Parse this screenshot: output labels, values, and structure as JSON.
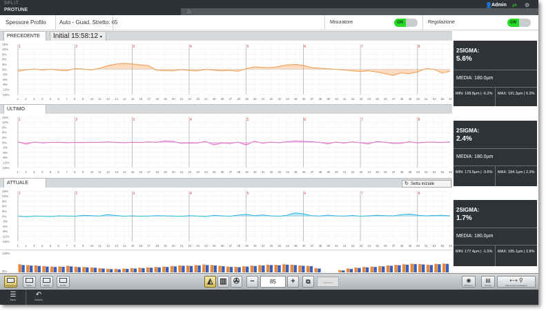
{
  "app": {
    "brand": "SPLIT",
    "product": "PROTUNE",
    "user": "Admin"
  },
  "header": {
    "profile_label": "Spessore Profilo",
    "mode": "Auto - Guad. Stretto: 65",
    "measurer_label": "Misuratore",
    "measurer_state": "ON",
    "regulation_label": "Regolazione",
    "regulation_state": "ON"
  },
  "panels": {
    "precedente": {
      "tab": "PRECEDENTE",
      "time": "Initial 15:58:12",
      "sigma_label": "2SIGMA:",
      "sigma_value": "5.6%",
      "media": "MEDIA: 180.0µm",
      "min": "MIN: 168.8µm | -6.2%",
      "max": "MAX: 191.3µm | 6.3%",
      "color": "#f39a4a"
    },
    "ultimo": {
      "tab": "ULTIMO",
      "sigma_label": "2SIGMA:",
      "sigma_value": "2.4%",
      "media": "MEDIA: 180.0µm",
      "min": "MIN: 173.5µm | -3.6%",
      "max": "MAX: 184.1µm | 2.3%",
      "color": "#e566c8"
    },
    "attuale": {
      "tab": "ATTUALE",
      "setta_label": "Setta iniziale",
      "sigma_label": "2SIGMA:",
      "sigma_value": "1.7%",
      "media": "MEDIA: 180.0µm",
      "min": "MIN: 177.4µm | -1.5%",
      "max": "MAX: 185.1µm | 2.8%",
      "color": "#2ab7e8"
    }
  },
  "chart_data": [
    {
      "type": "area",
      "name": "PRECEDENTE",
      "x": [
        1,
        2,
        3,
        4,
        5,
        6,
        7,
        8,
        9,
        10,
        11,
        12,
        13,
        14,
        15,
        16,
        17,
        18,
        19,
        20,
        21,
        22,
        23,
        24,
        25,
        26,
        27,
        28,
        29,
        30,
        31,
        32,
        33,
        34,
        35,
        36,
        37,
        38,
        39,
        40,
        41,
        42,
        43,
        44,
        45,
        46,
        47,
        48,
        49,
        50,
        51,
        52,
        53,
        54
      ],
      "values": [
        -1.2,
        -0.3,
        0.2,
        -0.5,
        0.1,
        -0.6,
        -0.8,
        0.4,
        0.2,
        -0.4,
        0.6,
        2.1,
        3.1,
        3.6,
        3.2,
        2.6,
        2.2,
        -0.6,
        -0.8,
        -0.9,
        -0.2,
        -0.7,
        -1.0,
        -0.1,
        -0.5,
        -0.9,
        -0.6,
        -1.2,
        0.4,
        1.5,
        1.2,
        1.0,
        1.7,
        2.6,
        2.9,
        2.3,
        1.1,
        0.6,
        0.3,
        0.0,
        -0.4,
        -1.0,
        -1.3,
        -0.9,
        -1.6,
        -2.5,
        -3.7,
        -2.1,
        -2.6,
        -1.6,
        0.4,
        0.1,
        -2.2,
        -1.2
      ],
      "ylim": [
        -15,
        15
      ],
      "y_ticks": [
        "15%",
        "12%",
        "9%",
        "6%",
        "3%",
        "0%",
        "-3%",
        "-6%",
        "-9%",
        "-12%",
        "-15%"
      ],
      "zone_markers": [
        "1",
        "2",
        "3",
        "4",
        "5",
        "6",
        "7",
        "8"
      ]
    },
    {
      "type": "area",
      "name": "ULTIMO",
      "x": [
        1,
        2,
        3,
        4,
        5,
        6,
        7,
        8,
        9,
        10,
        11,
        12,
        13,
        14,
        15,
        16,
        17,
        18,
        19,
        20,
        21,
        22,
        23,
        24,
        25,
        26,
        27,
        28,
        29,
        30,
        31,
        32,
        33,
        34,
        35,
        36,
        37,
        38,
        39,
        40,
        41,
        42,
        43,
        44,
        45,
        46,
        47,
        48,
        49,
        50,
        51,
        52,
        53,
        54
      ],
      "values": [
        0.3,
        -1.0,
        0.2,
        -0.3,
        0.0,
        0.1,
        -0.2,
        0.0,
        -0.1,
        0.1,
        0.0,
        0.3,
        0.0,
        -0.2,
        0.1,
        0.0,
        0.3,
        0.1,
        0.8,
        0.6,
        -0.5,
        -0.3,
        -0.4,
        0.6,
        -1.5,
        -0.4,
        -0.6,
        0.1,
        -1.6,
        0.7,
        -0.5,
        0.2,
        -0.2,
        0.4,
        0.8,
        0.6,
        0.4,
        0.0,
        -0.8,
        0.2,
        -0.4,
        0.3,
        -0.2,
        -0.9,
        0.5,
        0.1,
        -0.6,
        -0.5,
        0.4,
        -0.3,
        0.1,
        0.2,
        0.0,
        0.3
      ],
      "ylim": [
        -15,
        15
      ],
      "y_ticks": [
        "15%",
        "12%",
        "9%",
        "6%",
        "3%",
        "0%",
        "-3%",
        "-6%",
        "-9%",
        "-12%",
        "-15%"
      ],
      "zone_markers": [
        "1",
        "2",
        "3",
        "4",
        "5",
        "6",
        "7",
        "8"
      ]
    },
    {
      "type": "area",
      "name": "ATTUALE",
      "x": [
        1,
        2,
        3,
        4,
        5,
        6,
        7,
        8,
        9,
        10,
        11,
        12,
        13,
        14,
        15,
        16,
        17,
        18,
        19,
        20,
        21,
        22,
        23,
        24,
        25,
        26,
        27,
        28,
        29,
        30,
        31,
        32,
        33,
        34,
        35,
        36,
        37,
        38,
        39,
        40,
        41,
        42,
        43,
        44,
        45,
        46,
        47,
        48,
        49,
        50,
        51,
        52,
        53,
        54
      ],
      "values": [
        0.0,
        -0.3,
        0.1,
        0.0,
        -0.2,
        0.2,
        0.1,
        0.0,
        0.5,
        0.3,
        0.1,
        0.9,
        0.4,
        0.0,
        0.2,
        0.0,
        0.1,
        0.3,
        0.2,
        0.1,
        -0.1,
        0.3,
        0.1,
        -0.2,
        0.5,
        0.2,
        0.0,
        0.6,
        1.1,
        0.3,
        0.7,
        0.2,
        0.0,
        0.5,
        2.0,
        1.4,
        0.3,
        0.1,
        0.6,
        0.2,
        0.1,
        0.4,
        0.0,
        0.2,
        0.5,
        0.3,
        0.2,
        0.9,
        1.3,
        0.6,
        0.2,
        0.4,
        0.5,
        0.2
      ],
      "ylim": [
        -15,
        15
      ],
      "y_ticks": [
        "15%",
        "12%",
        "9%",
        "6%",
        "3%",
        "0%",
        "-3%",
        "-6%",
        "-9%",
        "-12%",
        "-15%"
      ],
      "zone_markers": [
        "1",
        "2",
        "3",
        "4",
        "5",
        "6",
        "7",
        "8"
      ]
    },
    {
      "type": "bar",
      "name": "histogram",
      "ylim": [
        0,
        100
      ],
      "y_ticks": [
        "100%",
        "0%"
      ],
      "x": [
        1,
        2,
        3,
        4,
        5,
        6,
        7,
        8,
        9,
        10,
        11,
        12,
        13,
        14,
        15,
        16,
        17,
        18,
        19,
        20,
        21,
        22,
        23,
        24,
        25,
        26,
        27,
        28,
        29,
        30,
        31,
        32,
        33,
        34,
        35,
        36,
        37,
        38,
        39,
        40,
        41,
        42,
        43,
        44,
        45,
        46,
        47,
        48,
        49,
        50,
        51,
        52,
        53,
        54
      ],
      "series": [
        {
          "values": [
            42,
            38,
            36,
            33,
            30,
            31,
            34,
            29,
            28,
            26,
            22,
            19,
            18,
            20,
            22,
            24,
            26,
            28,
            30,
            33,
            36,
            35,
            38,
            41,
            38,
            34,
            30,
            29,
            32,
            35,
            38,
            40,
            39,
            42,
            40,
            36,
            34,
            22,
            0,
            0,
            12,
            20,
            25,
            28,
            30,
            33,
            36,
            39,
            42,
            45,
            43,
            40,
            44,
            46
          ]
        },
        {
          "values": [
            38,
            35,
            33,
            30,
            28,
            29,
            31,
            27,
            26,
            24,
            20,
            17,
            16,
            18,
            20,
            22,
            24,
            26,
            28,
            31,
            34,
            33,
            36,
            38,
            36,
            32,
            28,
            27,
            30,
            33,
            36,
            38,
            37,
            40,
            38,
            34,
            32,
            20,
            0,
            0,
            10,
            18,
            23,
            26,
            28,
            31,
            34,
            37,
            40,
            43,
            41,
            38,
            42,
            44
          ]
        }
      ]
    }
  ],
  "toolbar": {
    "left_buttons": [
      "Precedente",
      "Ultimo",
      "Attuale",
      "Profilo"
    ],
    "value": "85",
    "disabled_label": "Applica",
    "right_buttons": [
      "Diffusione",
      "Ricetta",
      "Misurazione",
      "Guadagno"
    ]
  },
  "nav": {
    "menu_label": "Menu",
    "back_label": "Indietro"
  }
}
